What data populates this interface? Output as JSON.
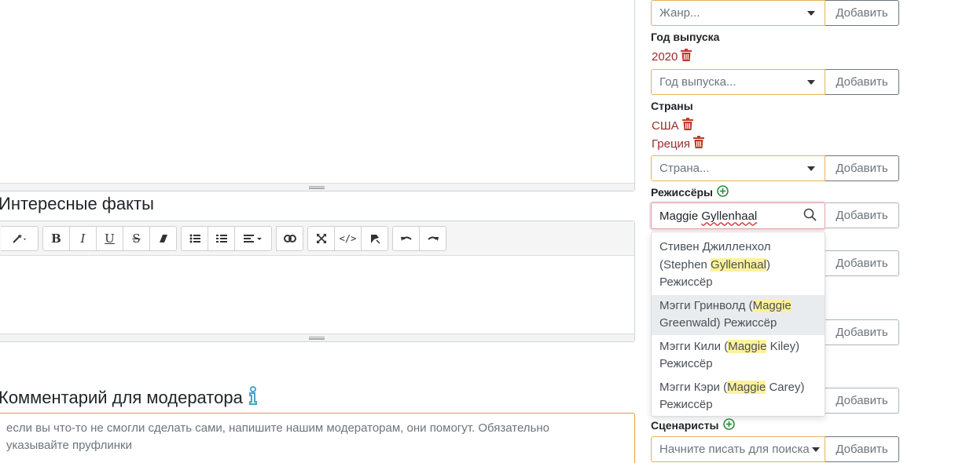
{
  "editor_top": {},
  "facts": {
    "title": "Интересные факты",
    "toolbar": {
      "groups": [
        [
          "magic-wand-icon"
        ],
        [
          "bold-icon",
          "italic-icon",
          "underline-icon",
          "strikethrough-icon",
          "eraser-icon"
        ],
        [
          "bullet-list-icon",
          "numbered-list-icon",
          "align-icon"
        ],
        [
          "link-icon"
        ],
        [
          "fullscreen-icon",
          "code-view-icon",
          "spoiler-icon"
        ],
        [
          "undo-icon",
          "redo-icon"
        ]
      ],
      "bold": "B",
      "italic": "I",
      "underline": "U",
      "strike": "S"
    }
  },
  "comment": {
    "title": "Комментарий для модератора",
    "placeholder_line1": "если вы что-то не смогли сделать сами, напишите нашим модераторам, они помогут. Обязательно",
    "placeholder_line2": "указывайте пруфлинки"
  },
  "sidebar": {
    "add_label": "Добавить",
    "genre": {
      "placeholder": "Жанр..."
    },
    "year": {
      "label": "Год выпуска",
      "values": [
        "2020"
      ],
      "placeholder": "Год выпуска..."
    },
    "countries": {
      "label": "Страны",
      "values": [
        "США",
        "Греция"
      ],
      "placeholder": "Страна..."
    },
    "directors": {
      "label": "Режиссёры",
      "search_value": "Maggie Gyllenhaal",
      "search_value_first": "Maggie ",
      "search_value_misspelled": "Gyllenhaal",
      "suggestions": [
        {
          "pre": "Стивен Джилленхол (Stephen ",
          "match": "Gyllenhaal",
          "post": ") Режиссёр"
        },
        {
          "pre": "Мэгги Гринволд (",
          "match": "Maggie",
          "post": " Greenwald) Режиссёр"
        },
        {
          "pre": "Мэгги Кили (",
          "match": "Maggie",
          "post": " Kiley) Режиссёр"
        },
        {
          "pre": "Мэгги Кэри (",
          "match": "Maggie",
          "post": " Carey) Режиссёр"
        }
      ]
    },
    "writers": {
      "label": "Сценаристы",
      "placeholder": "Начните писать для поиска"
    }
  },
  "colors": {
    "accent_border": "#e5b25b",
    "delete_red": "#9b2c2c",
    "add_green": "#2e8b3d",
    "highlight": "#fdf29b",
    "info_blue": "#4aa3c7"
  }
}
